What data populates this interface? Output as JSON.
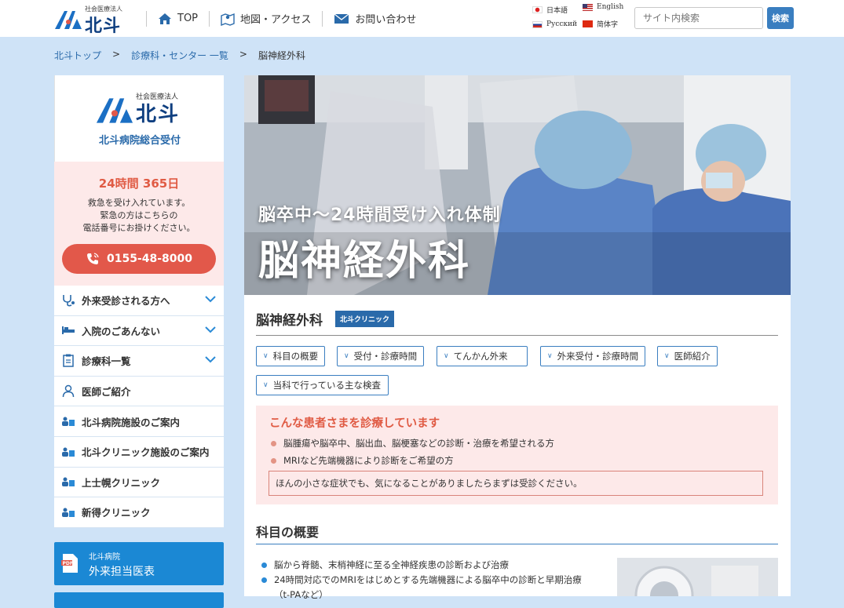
{
  "header": {
    "logo_small": "社会医療法人",
    "logo_name": "北斗",
    "nav": [
      {
        "label": "TOP",
        "icon": "home-icon"
      },
      {
        "label": "地図・アクセス",
        "icon": "map-icon"
      },
      {
        "label": "お問い合わせ",
        "icon": "mail-icon"
      }
    ],
    "languages": [
      "日本語",
      "English",
      "Русский",
      "简体字"
    ],
    "search_placeholder": "サイト内検索",
    "search_button": "検索"
  },
  "breadcrumb": {
    "home": "北斗トップ",
    "sep": ">",
    "list": "診療科・センター 一覧",
    "current": "脳神経外科"
  },
  "sidebar": {
    "logo_small": "社会医療法人",
    "logo_name": "北斗",
    "reception": "北斗病院総合受付",
    "emergency_title": "24時間 365日",
    "emergency_lines": [
      "救急を受け入れています。",
      "緊急の方はこちらの",
      "電話番号にお掛けください。"
    ],
    "phone": "0155-48-8000",
    "menu": [
      {
        "label": "外来受診される方へ",
        "icon": "stethoscope-icon",
        "chevron": true
      },
      {
        "label": "入院のごあんない",
        "icon": "bed-icon",
        "chevron": true
      },
      {
        "label": "診療科一覧",
        "icon": "clipboard-icon",
        "chevron": true
      },
      {
        "label": "医師ご紹介",
        "icon": "doctor-icon",
        "chevron": false
      },
      {
        "label": "北斗病院施設のご案内",
        "icon": "facility-icon",
        "chevron": false
      },
      {
        "label": "北斗クリニック施設のご案内",
        "icon": "facility-icon",
        "chevron": false
      },
      {
        "label": "上士幌クリニック",
        "icon": "facility-icon",
        "chevron": false
      },
      {
        "label": "新得クリニック",
        "icon": "facility-icon",
        "chevron": false
      }
    ],
    "pdf_small": "北斗病院",
    "pdf_label": "外来担当医表"
  },
  "hero": {
    "subtitle": "脳卒中～24時間受け入れ体制",
    "title": "脳神経外科"
  },
  "main": {
    "title": "脳神経外科",
    "badge": "北斗クリニック",
    "tabs": [
      "科目の概要",
      "受付・診療時間",
      "てんかん外来",
      "外来受付・診療時間",
      "医師紹介",
      "当科で行っている主な検査"
    ],
    "patients_title": "こんな患者さまを診療しています",
    "patients_items": [
      "脳腫瘍や脳卒中、脳出血、脳梗塞などの診断・治療を希望される方",
      "MRIなど先端機器により診断をご希望の方"
    ],
    "patients_note": "ほんの小さな症状でも、気になることがありましたらまずは受診ください。",
    "overview_title": "科目の概要",
    "overview_items": [
      "脳から脊髄、末梢神経に至る全神経疾患の診断および治療",
      "24時間対応でのMRIをはじめとする先端機器による脳卒中の診断と早期治療",
      "（t-PAなど）"
    ]
  },
  "colors": {
    "brand_blue": "#0f3f80",
    "accent_blue": "#3a7ec0",
    "emergency_red": "#e2584a",
    "emergency_bg": "#fde9e9",
    "page_bg": "#cfe3f7"
  }
}
